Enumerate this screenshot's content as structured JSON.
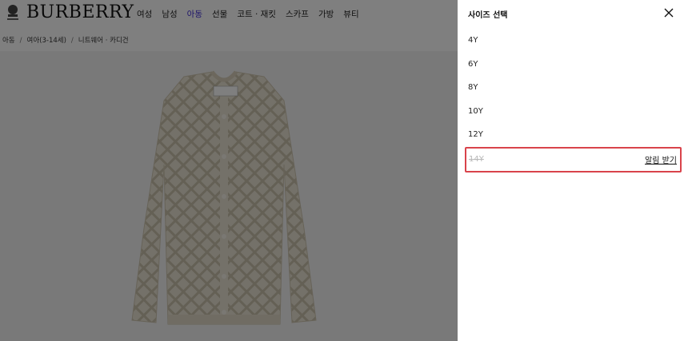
{
  "header": {
    "logo": "BURBERRY",
    "nav": [
      "여성",
      "남성",
      "아동",
      "선물",
      "코트 · 재킷",
      "스카프",
      "가방",
      "뷰티"
    ],
    "active_nav_index": 2,
    "accent_color": "#3f2bd6"
  },
  "breadcrumb": [
    "아동",
    "여아(3-14세)",
    "니트웨어 · 카디건"
  ],
  "drawer": {
    "title": "사이즈 선택",
    "close_icon": "close-icon",
    "sizes": [
      {
        "label": "4Y",
        "available": true
      },
      {
        "label": "6Y",
        "available": true
      },
      {
        "label": "8Y",
        "available": true
      },
      {
        "label": "10Y",
        "available": true
      },
      {
        "label": "12Y",
        "available": true
      },
      {
        "label": "14Y",
        "available": false,
        "action": "알림 받기"
      }
    ],
    "highlight_color": "#d9434b"
  }
}
